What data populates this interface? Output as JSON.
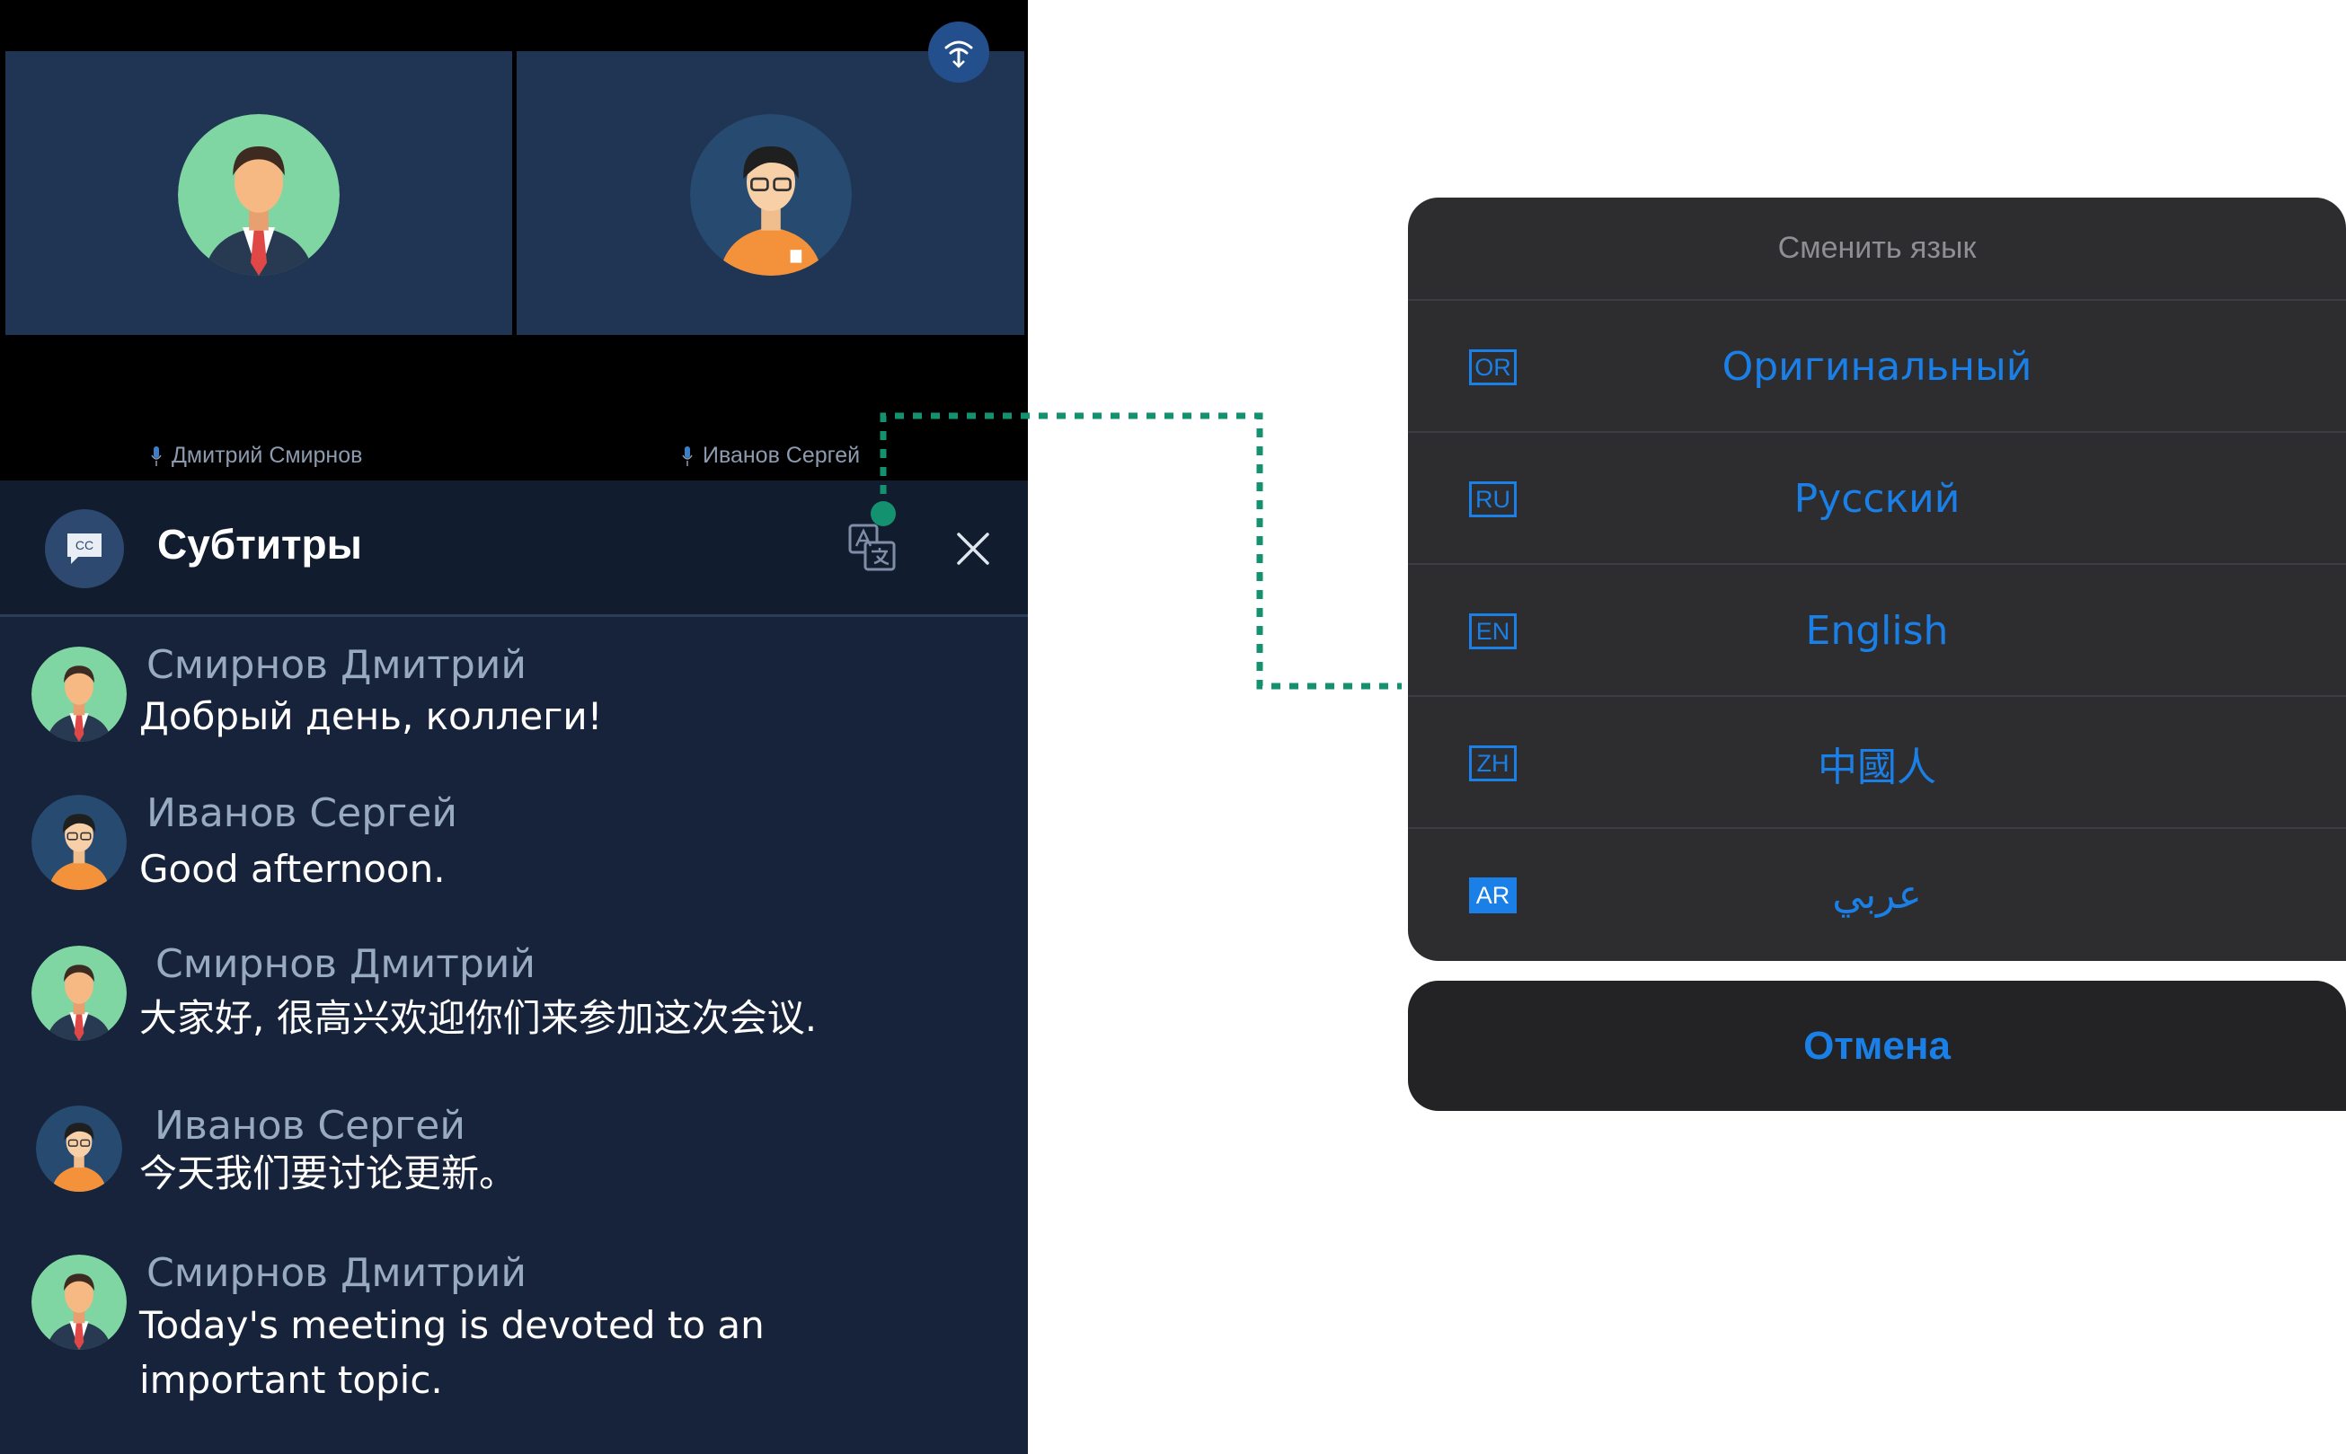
{
  "participants": [
    {
      "name": "Дмитрий Смирнов",
      "avatar": "man-suit-avatar"
    },
    {
      "name": "Иванов Сергей",
      "avatar": "man-glasses-avatar"
    }
  ],
  "icons": {
    "network": "network-signal-icon",
    "mic": "microphone-icon",
    "cc": "closed-captions-icon",
    "translate": "translate-icon",
    "close": "close-icon"
  },
  "subtitles": {
    "cc_badge": "CC",
    "title": "Субтитры",
    "messages": [
      {
        "author": "Смирнов Дмитрий",
        "text": "Добрый день, коллеги!",
        "avatar": "man-suit-avatar"
      },
      {
        "author": "Иванов Сергей",
        "text": "Good afternoon.",
        "avatar": "man-glasses-avatar"
      },
      {
        "author": "Смирнов Дмитрий",
        "text": "大家好, 很高兴欢迎你们来参加这次会议.",
        "avatar": "man-suit-avatar"
      },
      {
        "author": "Иванов Сергей",
        "text": "今天我们要讨论更新。",
        "avatar": "man-glasses-avatar"
      },
      {
        "author": "Смирнов Дмитрий",
        "text": "Today's meeting is devoted to an important topic.",
        "avatar": "man-suit-avatar"
      }
    ]
  },
  "language_sheet": {
    "title": "Сменить язык",
    "options": [
      {
        "code": "OR",
        "label": "Оригинальный",
        "selected": false
      },
      {
        "code": "RU",
        "label": "Русский",
        "selected": false
      },
      {
        "code": "EN",
        "label": "English",
        "selected": false
      },
      {
        "code": "ZH",
        "label": "中國人",
        "selected": false
      },
      {
        "code": "AR",
        "label": "عربي",
        "selected": true
      }
    ],
    "cancel_label": "Отмена"
  },
  "colors": {
    "app_background": "#17233a",
    "header_background": "#111c2e",
    "tile_background": "#1f3553",
    "sheet_background": "#2d2d30",
    "accent_blue": "#1a7fe6",
    "connector_green": "#14916e"
  }
}
